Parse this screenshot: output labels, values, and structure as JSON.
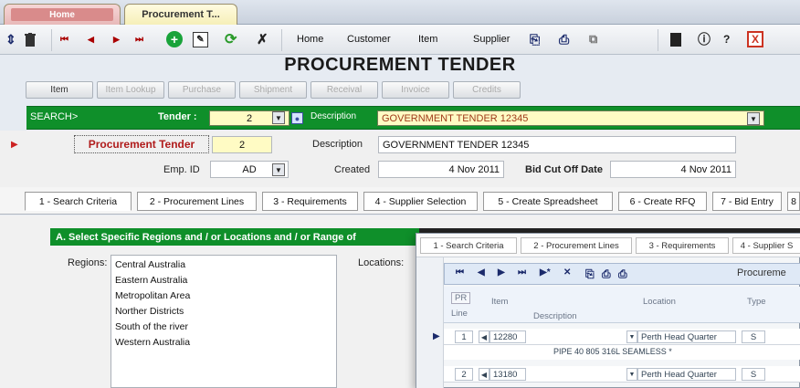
{
  "tabs": {
    "home_label": "Home",
    "procurement_label": "Procurement T..."
  },
  "toolbar": {
    "nav_first": "⏮",
    "nav_prev": "◀",
    "nav_next": "▶",
    "nav_last": "⏭",
    "menu_home": "Home",
    "menu_customer": "Customer",
    "menu_item": "Item",
    "menu_supplier": "Supplier"
  },
  "page": {
    "title": "PROCUREMENT TENDER"
  },
  "section_buttons": [
    "Item",
    "Item Lookup",
    "Purchase",
    "Shipment",
    "Receival",
    "Invoice",
    "Credits"
  ],
  "search": {
    "label": "SEARCH>",
    "tender_label": "Tender :",
    "tender_value": "2",
    "description_label": "Description",
    "description_value": "GOVERNMENT TENDER 12345"
  },
  "record": {
    "procurement_tender_label": "Procurement Tender",
    "procurement_tender_value": "2",
    "description_label": "Description",
    "description_value": "GOVERNMENT TENDER 12345",
    "emp_id_label": "Emp. ID",
    "emp_id_value": "AD",
    "created_label": "Created",
    "created_value": "4 Nov 2011",
    "bid_cut_off_label": "Bid Cut Off Date",
    "bid_cut_off_value": "4 Nov 2011"
  },
  "main_tabs": [
    "1 - Search Criteria",
    "2 - Procurement Lines",
    "3 - Requirements",
    "4 - Supplier Selection",
    "5 - Create Spreadsheet",
    "6 - Create RFQ",
    "7 - Bid Entry",
    "8"
  ],
  "regions_panel": {
    "heading": "A. Select Specific Regions and / or Locations and / or Range of",
    "regions_label": "Regions:",
    "locations_label": "Locations:",
    "regions": [
      "Central Australia",
      "Eastern Australia",
      "Metropolitan Area",
      "Norther Districts",
      "South of the river",
      "Western Australia"
    ]
  },
  "overlay": {
    "tabs": [
      "1 - Search Criteria",
      "2 - Procurement Lines",
      "3 - Requirements",
      "4 - Supplier S"
    ],
    "nav_title": "Procureme",
    "headers": {
      "pr_line": "PR",
      "line": "Line",
      "item": "Item",
      "description": "Description",
      "location": "Location",
      "type": "Type"
    },
    "rows": [
      {
        "line": "1",
        "item": "12280",
        "location": "Perth Head Quarter",
        "type": "S",
        "description": "PIPE 40 805 316L SEAMLESS *"
      },
      {
        "line": "2",
        "item": "13180",
        "location": "Perth Head Quarter",
        "type": "S",
        "description": ""
      }
    ]
  },
  "colors": {
    "green_bar": "#0f8f2a",
    "field_yellow": "#fffbc4",
    "label_red": "#b01b1b"
  }
}
